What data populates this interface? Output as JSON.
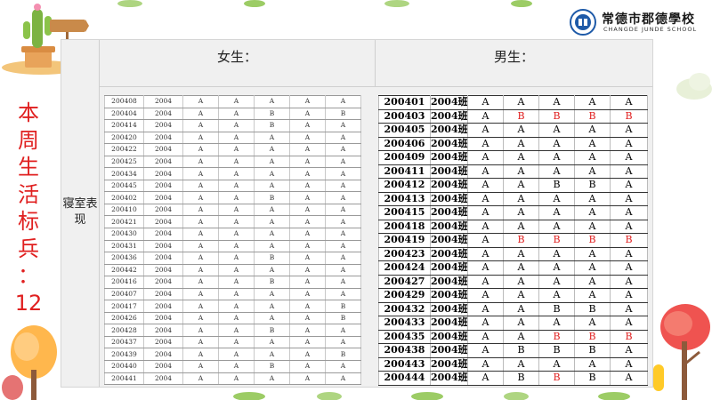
{
  "slide": {
    "side_title": [
      "本",
      "周",
      "生",
      "活",
      "标",
      "兵",
      "：",
      "12"
    ],
    "school_name": "常德市郡德學校",
    "school_name_en": "CHANGDE JUNDE SCHOOL",
    "row_label": "寝室表现",
    "girls_header": "女生：",
    "boys_header": "男生："
  },
  "girls_rows": [
    [
      "200408",
      "2004",
      "A",
      "A",
      "A",
      "A",
      "A"
    ],
    [
      "200404",
      "2004",
      "A",
      "A",
      "B",
      "A",
      "B"
    ],
    [
      "200414",
      "2004",
      "A",
      "A",
      "B",
      "A",
      "A"
    ],
    [
      "200420",
      "2004",
      "A",
      "A",
      "A",
      "A",
      "A"
    ],
    [
      "200422",
      "2004",
      "A",
      "A",
      "A",
      "A",
      "A"
    ],
    [
      "200425",
      "2004",
      "A",
      "A",
      "A",
      "A",
      "A"
    ],
    [
      "200434",
      "2004",
      "A",
      "A",
      "A",
      "A",
      "A"
    ],
    [
      "200445",
      "2004",
      "A",
      "A",
      "A",
      "A",
      "A"
    ],
    [
      "200402",
      "2004",
      "A",
      "A",
      "B",
      "A",
      "A"
    ],
    [
      "200410",
      "2004",
      "A",
      "A",
      "A",
      "A",
      "A"
    ],
    [
      "200421",
      "2004",
      "A",
      "A",
      "A",
      "A",
      "A"
    ],
    [
      "200430",
      "2004",
      "A",
      "A",
      "A",
      "A",
      "A"
    ],
    [
      "200431",
      "2004",
      "A",
      "A",
      "A",
      "A",
      "A"
    ],
    [
      "200436",
      "2004",
      "A",
      "A",
      "B",
      "A",
      "A"
    ],
    [
      "200442",
      "2004",
      "A",
      "A",
      "A",
      "A",
      "A"
    ],
    [
      "200416",
      "2004",
      "A",
      "A",
      "B",
      "A",
      "A"
    ],
    [
      "200407",
      "2004",
      "A",
      "A",
      "A",
      "A",
      "A"
    ],
    [
      "200417",
      "2004",
      "A",
      "A",
      "A",
      "A",
      "B"
    ],
    [
      "200426",
      "2004",
      "A",
      "A",
      "A",
      "A",
      "B"
    ],
    [
      "200428",
      "2004",
      "A",
      "A",
      "B",
      "A",
      "A"
    ],
    [
      "200437",
      "2004",
      "A",
      "A",
      "A",
      "A",
      "A"
    ],
    [
      "200439",
      "2004",
      "A",
      "A",
      "A",
      "A",
      "B"
    ],
    [
      "200440",
      "2004",
      "A",
      "A",
      "B",
      "A",
      "A"
    ],
    [
      "200441",
      "2004",
      "A",
      "A",
      "A",
      "A",
      "A"
    ]
  ],
  "boys_rows": [
    [
      "200401",
      "2004班",
      "A",
      "A",
      "A",
      "A",
      "A"
    ],
    [
      "200403",
      "2004班",
      "A",
      "B",
      "B",
      "B",
      "B"
    ],
    [
      "200405",
      "2004班",
      "A",
      "A",
      "A",
      "A",
      "A"
    ],
    [
      "200406",
      "2004班",
      "A",
      "A",
      "A",
      "A",
      "A"
    ],
    [
      "200409",
      "2004班",
      "A",
      "A",
      "A",
      "A",
      "A"
    ],
    [
      "200411",
      "2004班",
      "A",
      "A",
      "A",
      "A",
      "A"
    ],
    [
      "200412",
      "2004班",
      "A",
      "A",
      "B",
      "B",
      "A"
    ],
    [
      "200413",
      "2004班",
      "A",
      "A",
      "A",
      "A",
      "A"
    ],
    [
      "200415",
      "2004班",
      "A",
      "A",
      "A",
      "A",
      "A"
    ],
    [
      "200418",
      "2004班",
      "A",
      "A",
      "A",
      "A",
      "A"
    ],
    [
      "200419",
      "2004班",
      "A",
      "B",
      "B",
      "B",
      "B"
    ],
    [
      "200423",
      "2004班",
      "A",
      "A",
      "A",
      "A",
      "A"
    ],
    [
      "200424",
      "2004班",
      "A",
      "A",
      "A",
      "A",
      "A"
    ],
    [
      "200427",
      "2004班",
      "A",
      "A",
      "A",
      "A",
      "A"
    ],
    [
      "200429",
      "2004班",
      "A",
      "A",
      "A",
      "A",
      "A"
    ],
    [
      "200432",
      "2004班",
      "A",
      "A",
      "B",
      "B",
      "A"
    ],
    [
      "200433",
      "2004班",
      "A",
      "A",
      "A",
      "A",
      "A"
    ],
    [
      "200435",
      "2004班",
      "A",
      "A",
      "B",
      "B",
      "B"
    ],
    [
      "200438",
      "2004班",
      "A",
      "B",
      "B",
      "B",
      "A"
    ],
    [
      "200443",
      "2004班",
      "A",
      "A",
      "A",
      "A",
      "A"
    ],
    [
      "200444",
      "2004班",
      "A",
      "B",
      "B",
      "B",
      "A"
    ]
  ],
  "boys_red_cells": [
    [
      1,
      3
    ],
    [
      1,
      4
    ],
    [
      1,
      5
    ],
    [
      1,
      6
    ],
    [
      10,
      3
    ],
    [
      10,
      4
    ],
    [
      10,
      5
    ],
    [
      10,
      6
    ],
    [
      17,
      4
    ],
    [
      17,
      5
    ],
    [
      17,
      6
    ],
    [
      20,
      4
    ]
  ],
  "colors": {
    "accent_red": "#e02020"
  }
}
